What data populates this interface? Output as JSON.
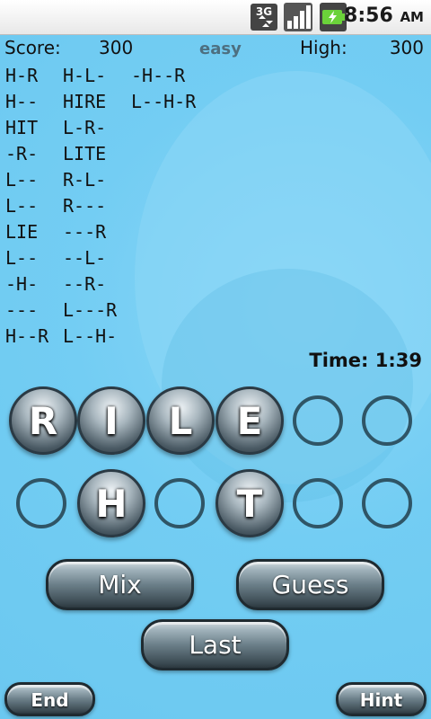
{
  "status_bar": {
    "network_icon": "3g-icon",
    "signal_icon": "signal-icon",
    "battery_icon": "battery-charging-icon",
    "time": "8:56",
    "ampm": "AM"
  },
  "header": {
    "score_label": "Score:",
    "score_value": "300",
    "difficulty": "easy",
    "high_label": "High:",
    "high_value": "300"
  },
  "words": {
    "column1": [
      "H-R",
      "H--",
      "HIT",
      "-R-",
      "L--",
      "L--",
      "LIE",
      "L--",
      "-H-",
      "---",
      "H--R"
    ],
    "column2": [
      "H-L-",
      "HIRE",
      "L-R-",
      "LITE",
      "R-L-",
      "R---",
      "---R",
      "--L-",
      "--R-",
      "L---R",
      "L--H-"
    ],
    "column3": [
      "-H--R",
      "L--H-R"
    ]
  },
  "timer": "Time: 1:39",
  "tiles": {
    "row1": [
      "R",
      "I",
      "L",
      "E",
      "",
      ""
    ],
    "row2": [
      "",
      "H",
      "",
      "T",
      "",
      ""
    ]
  },
  "buttons": {
    "mix": "Mix",
    "guess": "Guess",
    "last": "Last",
    "end": "End",
    "hint": "Hint"
  }
}
